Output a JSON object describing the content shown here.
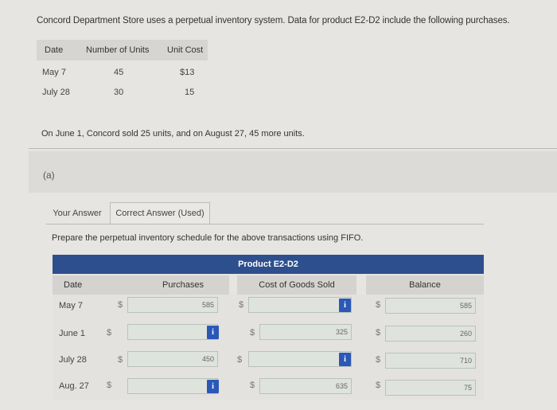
{
  "problem": {
    "statement": "Concord Department Store uses a perpetual inventory system. Data for product E2-D2 include the following purchases.",
    "sales_note": "On June 1, Concord sold 25 units, and on August 27, 45 more units."
  },
  "purchases": {
    "headers": [
      "Date",
      "Number of Units",
      "Unit Cost"
    ],
    "rows": [
      {
        "date": "May 7",
        "units": "45",
        "unit_cost": "$13"
      },
      {
        "date": "July 28",
        "units": "30",
        "unit_cost": "15"
      }
    ]
  },
  "part": {
    "label": "(a)"
  },
  "tabs": [
    "Your Answer",
    "Correct Answer (Used)"
  ],
  "schedule": {
    "instruction": "Prepare the perpetual inventory schedule for the above transactions using FIFO.",
    "title": "Product E2-D2",
    "columns": [
      "Date",
      "Purchases",
      "Cost of Goods Sold",
      "Balance"
    ],
    "currency": "$",
    "info_glyph": "i",
    "rows": [
      {
        "date": "May 7",
        "purchases": "585",
        "cogs": "",
        "balance": "585"
      },
      {
        "date": "June 1",
        "purchases": "",
        "cogs": "325",
        "balance": "260"
      },
      {
        "date": "July 28",
        "purchases": "450",
        "cogs": "",
        "balance": "710"
      },
      {
        "date": "Aug. 27",
        "purchases": "",
        "cogs": "635",
        "balance": "75"
      }
    ]
  },
  "colors": {
    "title_bar": "#2e4f8e",
    "info_icon": "#2b58b6",
    "background": "#e6e5e1"
  }
}
